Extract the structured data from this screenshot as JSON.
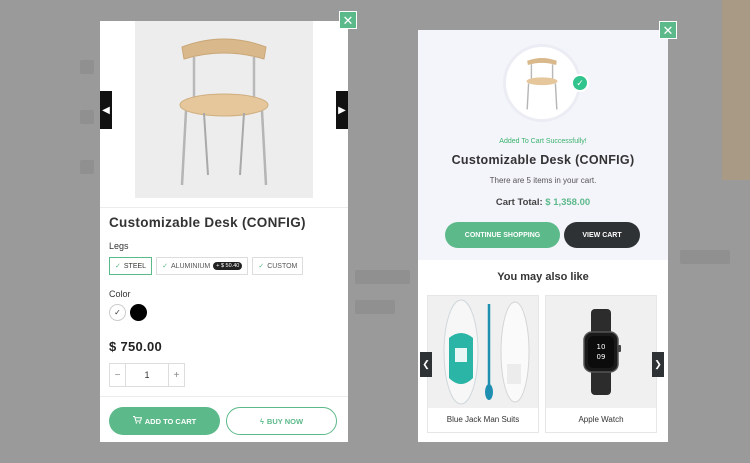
{
  "colors": {
    "accent": "#5cb98a",
    "dark_button": "#2f3234",
    "success": "#3bb36d",
    "overlay": "#8f8f8f"
  },
  "quick_view": {
    "close_icon": "close-icon",
    "prev_icon": "chevron-left-icon",
    "next_icon": "chevron-right-icon",
    "product_title": "Customizable Desk (CONFIG)",
    "legs_label": "Legs",
    "legs_options": [
      {
        "label": "STEEL",
        "selected": true
      },
      {
        "label": "ALUMINIUM",
        "price_extra": "+ $ 50.40",
        "selected": false
      },
      {
        "label": "CUSTOM",
        "selected": false
      }
    ],
    "color_label": "Color",
    "color_options": [
      {
        "name": "white",
        "hex": "#ffffff",
        "selected": true
      },
      {
        "name": "black",
        "hex": "#000000",
        "selected": false
      }
    ],
    "price": "$ 750.00",
    "quantity": "1",
    "qty_minus": "−",
    "qty_plus": "+",
    "add_to_cart_label": "ADD TO CART",
    "buy_now_label": "BUY NOW"
  },
  "cart_confirmation": {
    "success_message": "Added To Cart Successfully!",
    "product_title": "Customizable Desk (CONFIG)",
    "cart_count_text": "There are 5 items in your cart.",
    "cart_total_label": "Cart Total:",
    "cart_total_value": "$ 1,358.00",
    "continue_label": "CONTINUE SHOPPING",
    "view_cart_label": "VIEW CART",
    "also_like_title": "You may also like",
    "recommendations": [
      {
        "name": "Blue Jack Man Suits"
      },
      {
        "name": "Apple Watch"
      }
    ]
  }
}
